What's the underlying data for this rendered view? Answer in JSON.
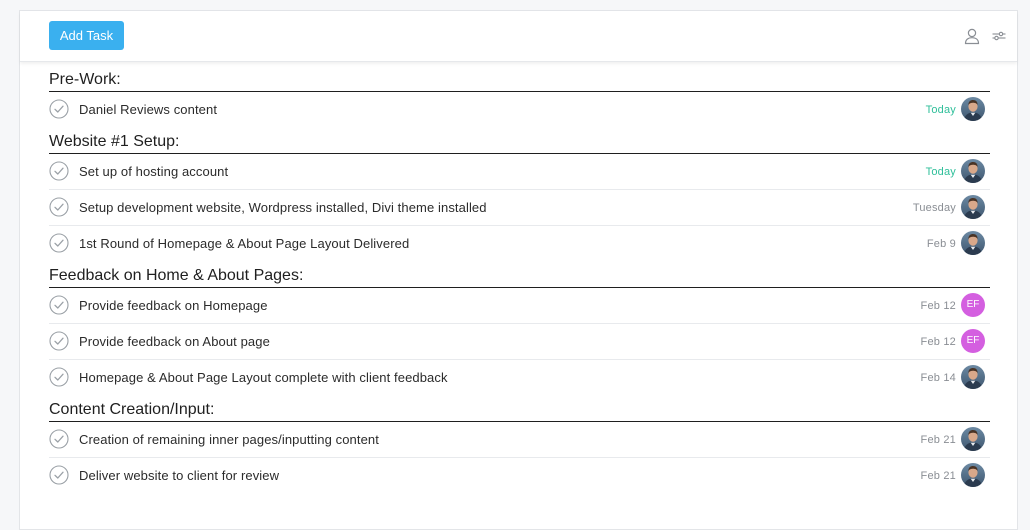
{
  "toolbar": {
    "add_task_label": "Add Task",
    "icons": [
      "user-icon",
      "filter-sliders-icon"
    ]
  },
  "colors": {
    "accent": "#3ab0ef",
    "today": "#2fbf9a",
    "initials_avatar": "#d45fe0"
  },
  "sections": [
    {
      "title": "Pre-Work:",
      "tasks": [
        {
          "name": "Daniel Reviews content",
          "date": "Today",
          "avatar": "photo"
        }
      ]
    },
    {
      "title": "Website #1 Setup:",
      "tasks": [
        {
          "name": "Set up of hosting account",
          "date": "Today",
          "avatar": "photo"
        },
        {
          "name": "Setup development website, Wordpress installed, Divi theme installed",
          "date": "Tuesday",
          "avatar": "photo"
        },
        {
          "name": "1st Round of Homepage & About Page Layout Delivered",
          "date": "Feb 9",
          "avatar": "photo"
        }
      ]
    },
    {
      "title": "Feedback on Home & About Pages:",
      "tasks": [
        {
          "name": "Provide feedback on Homepage",
          "date": "Feb 12",
          "avatar": "EF"
        },
        {
          "name": "Provide feedback on About page",
          "date": "Feb 12",
          "avatar": "EF"
        },
        {
          "name": "Homepage & About Page Layout complete with client feedback",
          "date": "Feb 14",
          "avatar": "photo"
        }
      ]
    },
    {
      "title": "Content Creation/Input:",
      "tasks": [
        {
          "name": "Creation of remaining inner pages/inputting content",
          "date": "Feb 21",
          "avatar": "photo"
        },
        {
          "name": "Deliver website to client for review",
          "date": "Feb 21",
          "avatar": "photo"
        }
      ]
    }
  ]
}
